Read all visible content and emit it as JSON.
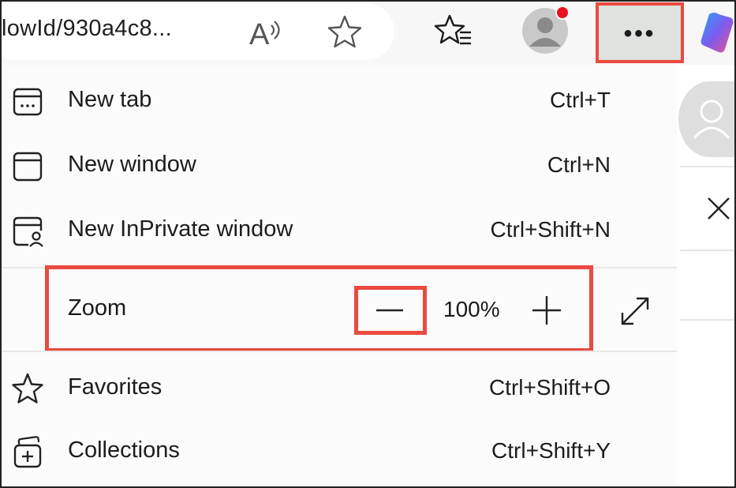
{
  "toolbar": {
    "url_fragment": "lowId/930a4c8...",
    "read_aloud_icon": "read-aloud-icon",
    "favorite_icon": "star-icon",
    "favorites_list_icon": "favorites-list-icon",
    "profile_icon": "profile-avatar-icon",
    "more_label": "•••",
    "copilot_icon": "copilot-icon"
  },
  "menu": {
    "items": [
      {
        "label": "New tab",
        "shortcut": "Ctrl+T",
        "icon": "new-tab-icon"
      },
      {
        "label": "New window",
        "shortcut": "Ctrl+N",
        "icon": "new-window-icon"
      },
      {
        "label": "New InPrivate window",
        "shortcut": "Ctrl+Shift+N",
        "icon": "inprivate-window-icon"
      },
      {
        "label": "Favorites",
        "shortcut": "Ctrl+Shift+O",
        "icon": "star-icon"
      },
      {
        "label": "Collections",
        "shortcut": "Ctrl+Shift+Y",
        "icon": "collections-icon"
      }
    ],
    "zoom": {
      "label": "Zoom",
      "value": "100%",
      "minus_icon": "minus-icon",
      "plus_icon": "plus-icon",
      "fullscreen_icon": "fullscreen-icon"
    }
  },
  "colors": {
    "highlight": "#ea4a3f",
    "notification_dot": "#e8121f",
    "toolbar_bg": "#f7f7f7",
    "menu_bg": "#fbfbfb"
  }
}
